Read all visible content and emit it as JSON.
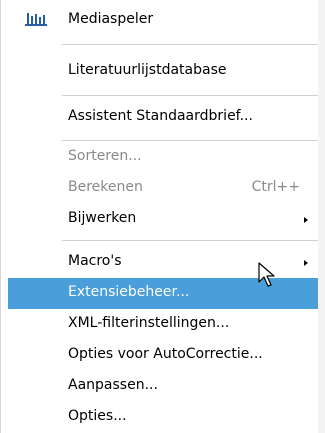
{
  "menu": {
    "items": [
      {
        "label": "Mediaspeler",
        "mnemonic": "d",
        "icon": "media-player-icon",
        "state": "normal"
      },
      {
        "label": "Literatuurlijstdatabase",
        "mnemonic": "L",
        "state": "normal"
      },
      {
        "label": "Assistent Standaardbrief...",
        "mnemonic": "f",
        "state": "normal"
      },
      {
        "label": "Sorteren...",
        "mnemonic": "t",
        "state": "disabled"
      },
      {
        "label": "Berekenen",
        "mnemonic": "k",
        "shortcut": "Ctrl++",
        "state": "disabled"
      },
      {
        "label": "Bijwerken",
        "mnemonic": "B",
        "submenu": true,
        "state": "normal"
      },
      {
        "label": "Macro's",
        "mnemonic": "M",
        "submenu": true,
        "state": "normal"
      },
      {
        "label": "Extensiebeheer...",
        "mnemonic": "E",
        "state": "highlighted"
      },
      {
        "label": "XML-filterinstellingen...",
        "mnemonic": "X",
        "state": "normal"
      },
      {
        "label": "Opties voor AutoCorrectie...",
        "mnemonic": "A",
        "state": "normal"
      },
      {
        "label": "Aanpassen...",
        "mnemonic": "A",
        "state": "normal"
      },
      {
        "label": "Opties...",
        "mnemonic": "O",
        "state": "normal"
      }
    ]
  },
  "colors": {
    "highlight": "#4a9ed9",
    "disabled_text": "#8a8a8a",
    "separator": "#d0d0d0"
  }
}
